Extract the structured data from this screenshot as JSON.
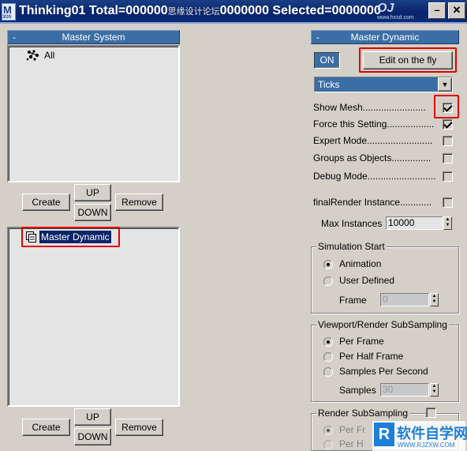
{
  "window": {
    "title_left": "Thinking01  Total=000000",
    "title_watermark": "思缘设计论坛",
    "title_right": "0000000  Selected=0000000",
    "app_icon_letter": "M",
    "app_icon_sub": "3DS",
    "logo_text": "OJ",
    "logo_url": "www.hxsd.com",
    "minimize_glyph": "–",
    "close_glyph": "✕"
  },
  "left_panel": {
    "master_system": {
      "collapse_glyph": "-",
      "title": "Master System",
      "items": [
        {
          "label": "All",
          "icon": "particle-system-icon"
        }
      ],
      "buttons": {
        "create": "Create",
        "up": "UP",
        "down": "DOWN",
        "remove": "Remove"
      }
    },
    "dynamic_list": {
      "items": [
        {
          "label": "Master Dynamic",
          "icon": "dynamics-icon",
          "selected": true
        }
      ],
      "buttons": {
        "create": "Create",
        "up": "UP",
        "down": "DOWN",
        "remove": "Remove"
      }
    }
  },
  "right_panel": {
    "collapse_glyph": "-",
    "title": "Master Dynamic",
    "on_button": "ON",
    "edit_on_fly_button": "Edit on the fly",
    "time_dropdown": {
      "selected": "Ticks",
      "arrow": "▼"
    },
    "options": [
      {
        "label": "Show Mesh........................",
        "checked": true
      },
      {
        "label": "Force this Setting..................",
        "checked": true
      },
      {
        "label": "Expert Mode.........................",
        "checked": false
      },
      {
        "label": "Groups as Objects...............",
        "checked": false
      },
      {
        "label": "Debug Mode..........................",
        "checked": false
      },
      {
        "label": "finalRender Instance............",
        "checked": false
      }
    ],
    "max_instances": {
      "label": "Max Instances",
      "value": "10000"
    },
    "simulation_start": {
      "title": "Simulation Start",
      "options": [
        {
          "label": "Animation",
          "selected": true
        },
        {
          "label": "User Defined",
          "selected": false
        }
      ],
      "frame": {
        "label": "Frame",
        "value": "0"
      }
    },
    "viewport_subsampling": {
      "title": "Viewport/Render SubSampling",
      "options": [
        {
          "label": "Per Frame",
          "selected": true
        },
        {
          "label": "Per Half Frame",
          "selected": false
        },
        {
          "label": "Samples Per Second",
          "selected": false
        }
      ],
      "samples": {
        "label": "Samples",
        "value": "30"
      }
    },
    "render_subsampling": {
      "title": "Render SubSampling",
      "options": [
        {
          "label": "Per Fr"
        },
        {
          "label": "Per H"
        }
      ]
    }
  },
  "watermark_bottom": {
    "cn": "软件自学网",
    "url": "WWW.RJZXW.COM"
  },
  "colors": {
    "titlebar": "#0a246a",
    "rollout": "#3a6ea5",
    "panel_bg": "#d4d0c8",
    "selection": "#0a246a",
    "highlight_box": "#e00000"
  }
}
